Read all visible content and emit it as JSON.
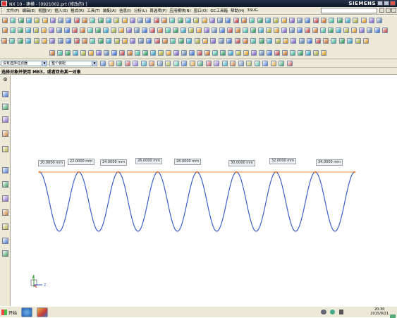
{
  "window": {
    "title": "NX 10 - 建模 - [0921002.prt (修改的) ]",
    "brand": "SIEMENS"
  },
  "menu": {
    "items": [
      "文件(F)",
      "编辑(E)",
      "视图(V)",
      "插入(S)",
      "格式(R)",
      "工具(T)",
      "装配(A)",
      "信息(I)",
      "分析(L)",
      "首选项(P)",
      "应用模块(N)",
      "窗口(O)",
      "GC工具箱",
      "帮助(H)",
      "3SUG"
    ]
  },
  "filterbar": {
    "type_filter": "没有选择过滤器",
    "scope_filter": "整个装配"
  },
  "status": {
    "message": "选择对象并使用 MB3，或者双击某一对象"
  },
  "canvas": {
    "curve_color": "#3c5fc8",
    "dim_color": "#f08c3c",
    "dimensions": [
      "20.0000 mm",
      "22.0000 mm",
      "24.0000 mm",
      "26.0000 mm",
      "28.0000 mm",
      "30.0000 mm",
      "32.0000 mm",
      "34.0000 mm"
    ],
    "axis_label": "Z"
  },
  "taskbar": {
    "start_label": "开始",
    "time": "20:30",
    "date": "2015/9/21"
  }
}
